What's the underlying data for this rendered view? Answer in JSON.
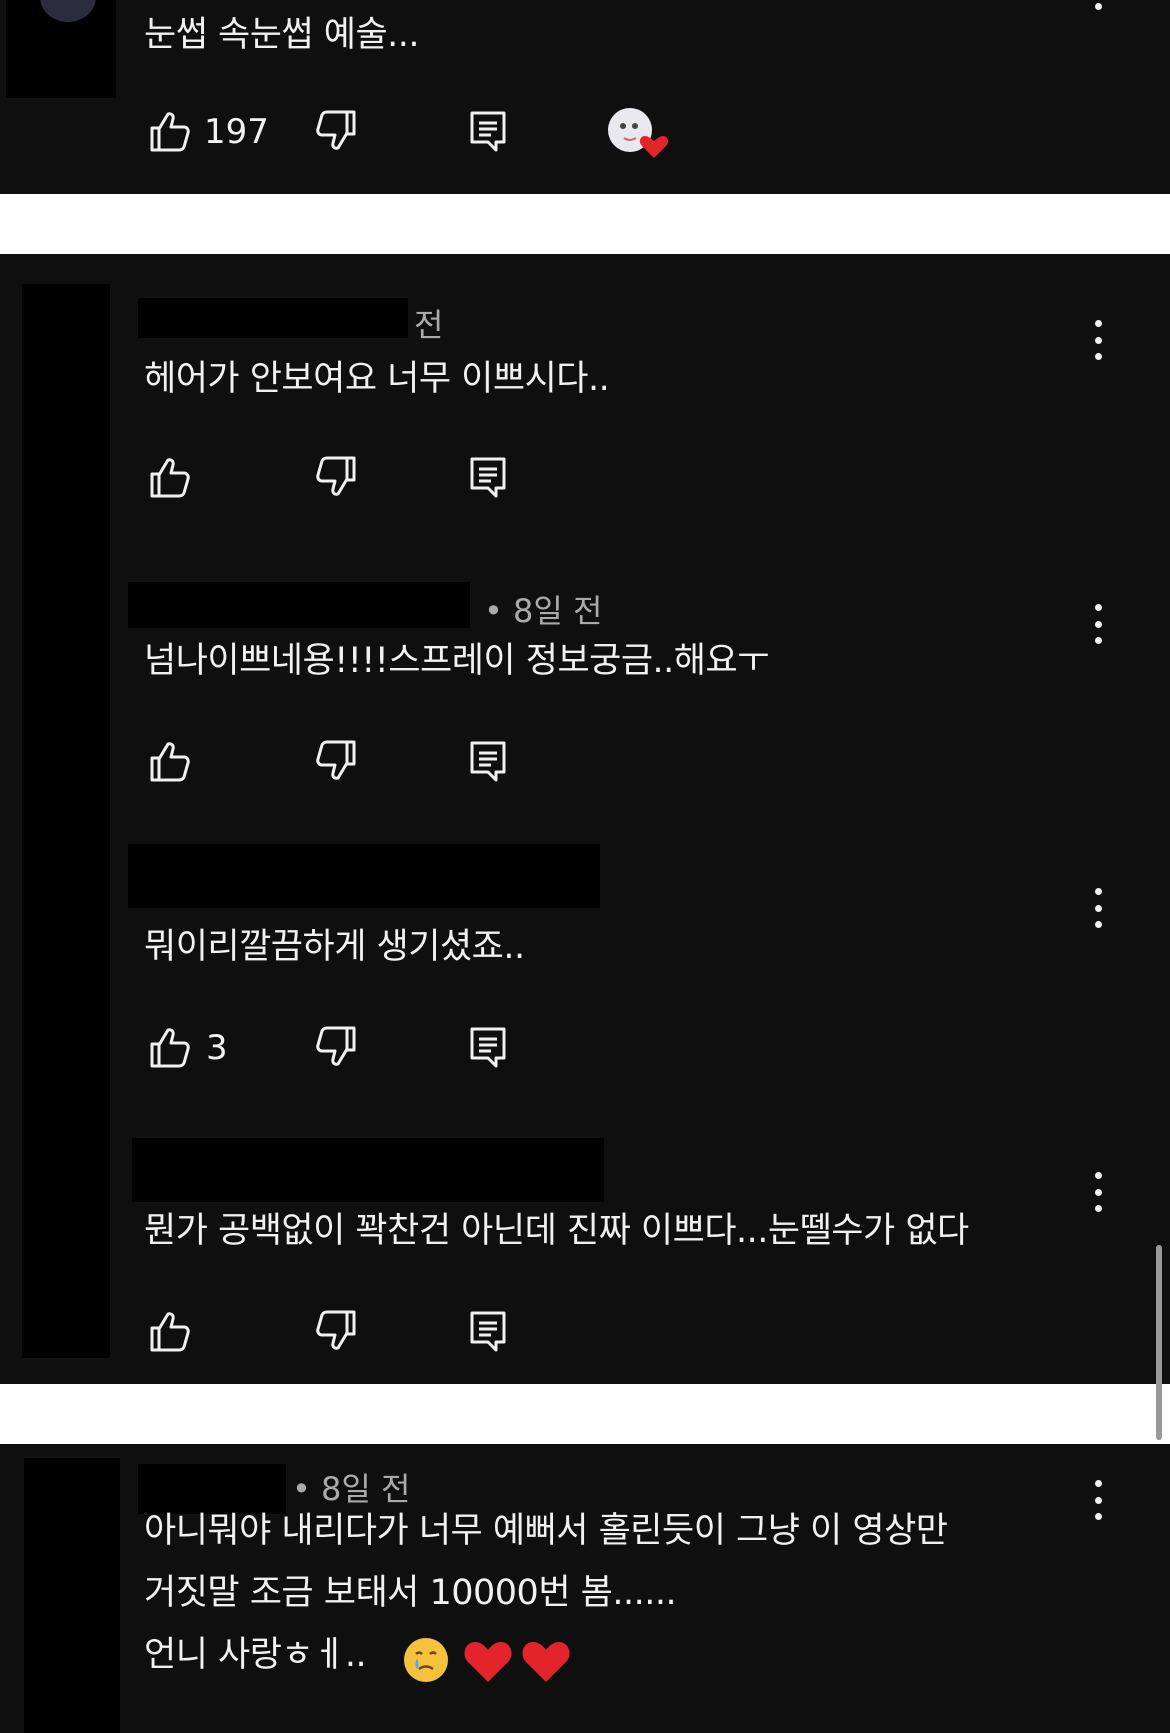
{
  "comments_top": {
    "text": "눈썹 속눈썹 예술...",
    "likes": "197"
  },
  "thread": {
    "parent": {
      "time": "전",
      "text": "헤어가 안보여요 너무 이쁘시다..",
      "likes": ""
    },
    "replies": [
      {
        "time": "• 8일 전",
        "text": "넘나이쁘네용!!!!스프레이 정보궁금..해요ㅜ",
        "likes": ""
      },
      {
        "time": "",
        "text": "뭐이리깔끔하게 생기셨죠..",
        "likes": "3"
      },
      {
        "time": "",
        "text": "뭔가 공백없이 꽉찬건 아닌데 진짜 이쁘다...눈뗄수가 없다",
        "likes": ""
      }
    ]
  },
  "bottom_comment": {
    "time": "• 8일 전",
    "lines": [
      "아니뭐야 내리다가 너무 예뻐서 홀린듯이 그냥 이 영상만",
      "거짓말 조금 보태서 10000번 봄......",
      "언니 사랑ㅎㅔ.."
    ]
  },
  "icons": {
    "like": "thumb-up-icon",
    "dislike": "thumb-down-icon",
    "reply": "reply-icon",
    "menu": "more-vert-icon",
    "creator_heart": "creator-heart-icon"
  },
  "colors": {
    "panel_bg": "#0f0f0f",
    "text": "#f1f1f1",
    "meta": "#aaaaaa",
    "heart": "#e3242b"
  }
}
